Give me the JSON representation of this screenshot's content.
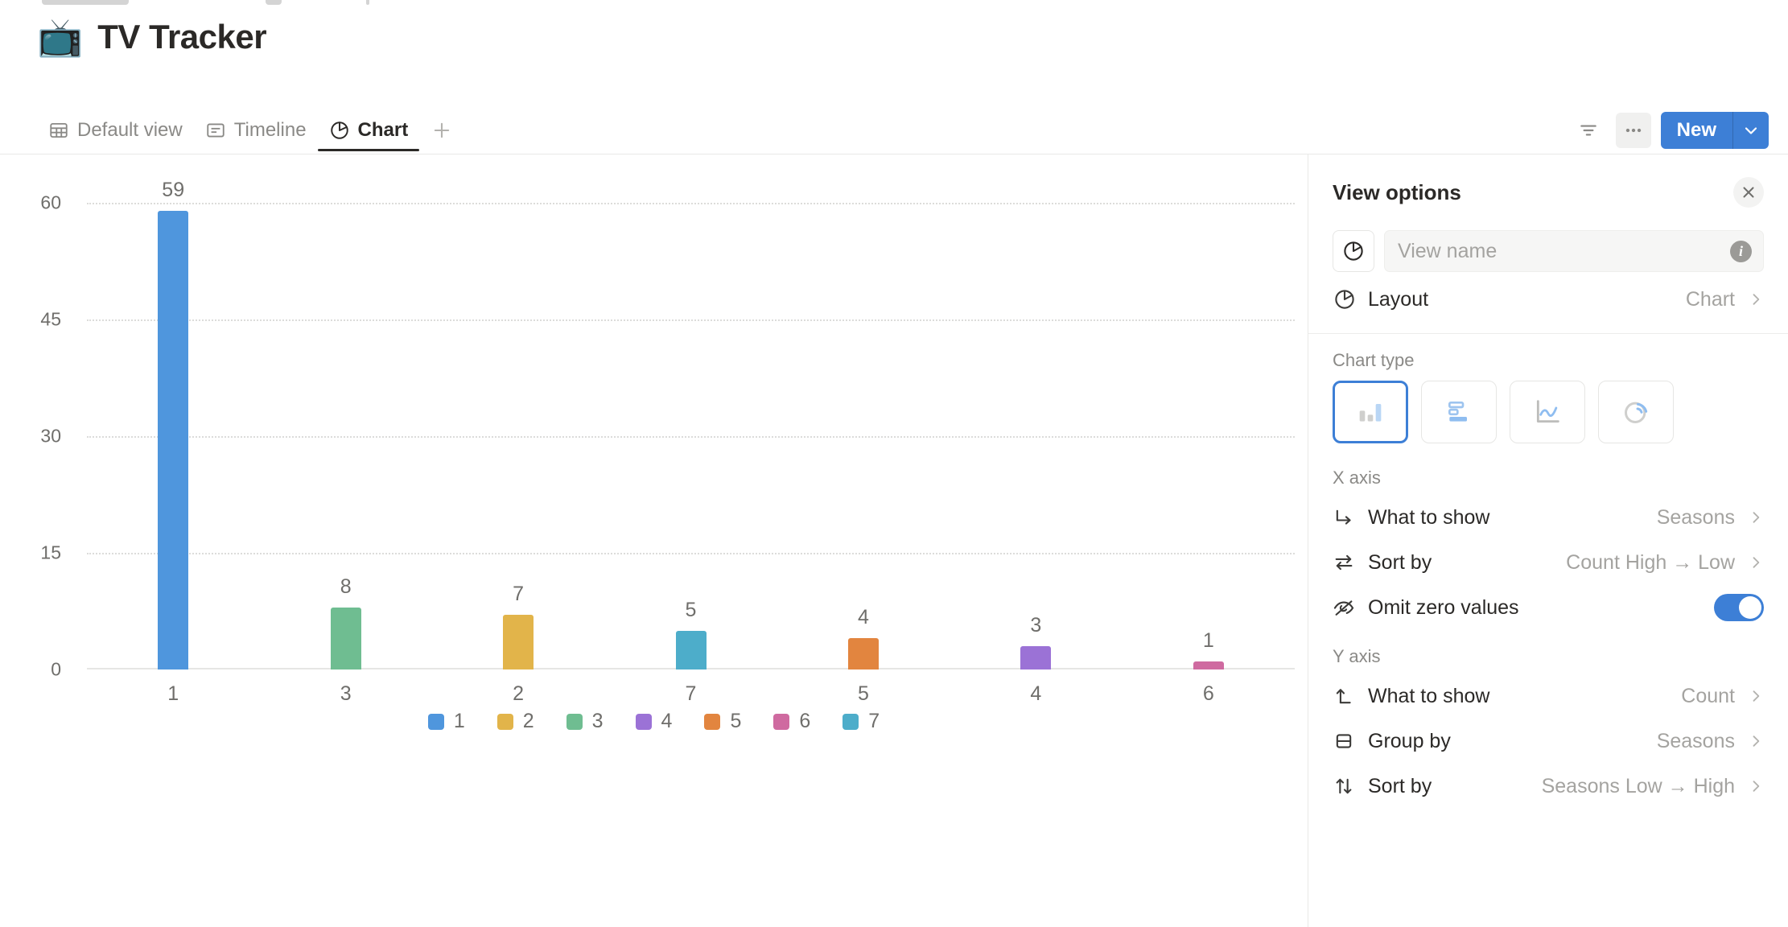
{
  "header": {
    "emoji": "📺",
    "title": "TV Tracker"
  },
  "tabs": [
    {
      "label": "Default view",
      "icon": "table-icon",
      "active": false
    },
    {
      "label": "Timeline",
      "icon": "timeline-icon",
      "active": false
    },
    {
      "label": "Chart",
      "icon": "chart-pie-icon",
      "active": true
    }
  ],
  "toolbar": {
    "add_view_label": "+",
    "filter_icon": "filter-icon",
    "more_icon": "more-horizontal-icon",
    "new_label": "New",
    "new_caret_icon": "chevron-down-icon"
  },
  "panel": {
    "title": "View options",
    "close_icon": "close-icon",
    "view_name_placeholder": "View name",
    "view_name_value": "",
    "layout": {
      "label": "Layout",
      "value": "Chart"
    },
    "chart_type_section": "Chart type",
    "chart_types": [
      {
        "name": "vertical-bar-chart-icon",
        "selected": true
      },
      {
        "name": "horizontal-bar-chart-icon",
        "selected": false
      },
      {
        "name": "line-chart-icon",
        "selected": false
      },
      {
        "name": "donut-chart-icon",
        "selected": false
      }
    ],
    "x_axis": {
      "section": "X axis",
      "rows": [
        {
          "label": "What to show",
          "value": "Seasons",
          "icon": "arrow-corner-icon",
          "type": "nav"
        },
        {
          "label": "Sort by",
          "value": "Count High → Low",
          "icon": "swap-icon",
          "type": "nav"
        },
        {
          "label": "Omit zero values",
          "value": "",
          "icon": "eye-off-icon",
          "type": "toggle",
          "toggle_on": true
        }
      ]
    },
    "y_axis": {
      "section": "Y axis",
      "rows": [
        {
          "label": "What to show",
          "value": "Count",
          "icon": "arrow-up-corner-icon",
          "type": "nav"
        },
        {
          "label": "Group by",
          "value": "Seasons",
          "icon": "group-rows-icon",
          "type": "nav"
        },
        {
          "label": "Sort by",
          "value": "Seasons Low → High",
          "icon": "sort-updown-icon",
          "type": "nav"
        }
      ]
    }
  },
  "colors": {
    "accent": "#3d7fd6",
    "series_1": "#4f96dd",
    "series_2": "#e2b44a",
    "series_3": "#6fbd91",
    "series_4": "#9b72d6",
    "series_5": "#e2853f",
    "series_6": "#cf6aa0",
    "series_7": "#4dadca"
  },
  "chart_data": {
    "type": "bar",
    "title": "",
    "xlabel": "",
    "ylabel": "",
    "ylim": [
      0,
      60
    ],
    "yticks": [
      0,
      15,
      30,
      45,
      60
    ],
    "grid": true,
    "categories": [
      "1",
      "3",
      "2",
      "7",
      "5",
      "4",
      "6"
    ],
    "values": [
      59,
      8,
      7,
      5,
      4,
      3,
      1
    ],
    "bar_colors": [
      "#4f96dd",
      "#6fbd91",
      "#e2b44a",
      "#4dadca",
      "#e2853f",
      "#9b72d6",
      "#cf6aa0"
    ],
    "data_labels": [
      "59",
      "8",
      "7",
      "5",
      "4",
      "3",
      "1"
    ],
    "legend_position": "bottom",
    "legend": [
      {
        "label": "1",
        "color": "#4f96dd"
      },
      {
        "label": "2",
        "color": "#e2b44a"
      },
      {
        "label": "3",
        "color": "#6fbd91"
      },
      {
        "label": "4",
        "color": "#9b72d6"
      },
      {
        "label": "5",
        "color": "#e2853f"
      },
      {
        "label": "6",
        "color": "#cf6aa0"
      },
      {
        "label": "7",
        "color": "#4dadca"
      }
    ]
  }
}
